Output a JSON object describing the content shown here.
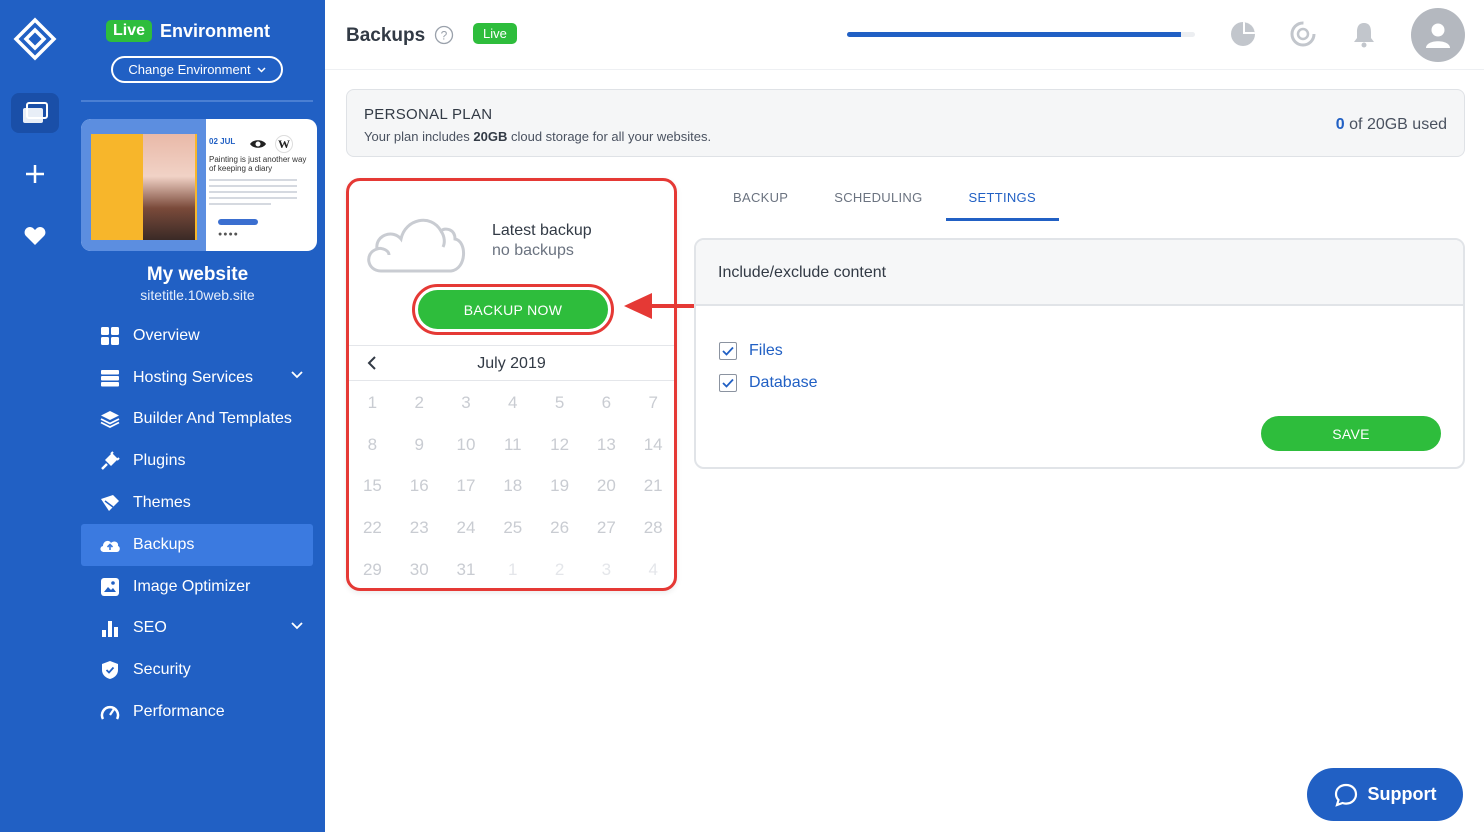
{
  "sidebar": {
    "live_badge": "Live",
    "environment_label": "Environment",
    "change_env_label": "Change Environment",
    "preview": {
      "date": "02 JUL",
      "text": "Painting is just another way of keeping a diary"
    },
    "site_name": "My website",
    "site_url": "sitetitle.10web.site",
    "items": [
      {
        "label": "Overview",
        "icon": "grid-icon"
      },
      {
        "label": "Hosting Services",
        "icon": "server-icon",
        "expandable": true
      },
      {
        "label": "Builder And Templates",
        "icon": "layers-icon"
      },
      {
        "label": "Plugins",
        "icon": "plug-icon"
      },
      {
        "label": "Themes",
        "icon": "brush-icon"
      },
      {
        "label": "Backups",
        "icon": "cloud-icon",
        "active": true
      },
      {
        "label": "Image Optimizer",
        "icon": "image-icon"
      },
      {
        "label": "SEO",
        "icon": "bar-chart-icon",
        "expandable": true
      },
      {
        "label": "Security",
        "icon": "shield-icon"
      },
      {
        "label": "Performance",
        "icon": "gauge-icon"
      }
    ]
  },
  "topbar": {
    "title": "Backups",
    "live_badge": "Live",
    "progress": 0.96
  },
  "plan": {
    "title": "PERSONAL PLAN",
    "desc_prefix": "Your plan includes ",
    "desc_bold": "20GB",
    "desc_suffix": " cloud storage for all your websites.",
    "used_num": "0",
    "used_suffix": " of 20GB used"
  },
  "backup_card": {
    "latest_title": "Latest backup",
    "latest_sub": "no backups",
    "backup_now": "BACKUP NOW",
    "calendar": {
      "month": "July 2019",
      "days": [
        "1",
        "2",
        "3",
        "4",
        "5",
        "6",
        "7",
        "8",
        "9",
        "10",
        "11",
        "12",
        "13",
        "14",
        "15",
        "16",
        "17",
        "18",
        "19",
        "20",
        "21",
        "22",
        "23",
        "24",
        "25",
        "26",
        "27",
        "28",
        "29",
        "30",
        "31"
      ],
      "next_days": [
        "1",
        "2",
        "3",
        "4"
      ]
    }
  },
  "tabs": [
    {
      "label": "BACKUP",
      "active": false
    },
    {
      "label": "SCHEDULING",
      "active": false
    },
    {
      "label": "SETTINGS",
      "active": true
    }
  ],
  "settings": {
    "title": "Include/exclude content",
    "options": [
      {
        "label": "Files",
        "checked": true
      },
      {
        "label": "Database",
        "checked": true
      }
    ],
    "save": "SAVE"
  },
  "support": {
    "label": "Support"
  },
  "colors": {
    "brand_blue": "#2160c4",
    "live_green": "#2ebd3c",
    "highlight_red": "#e53935"
  }
}
